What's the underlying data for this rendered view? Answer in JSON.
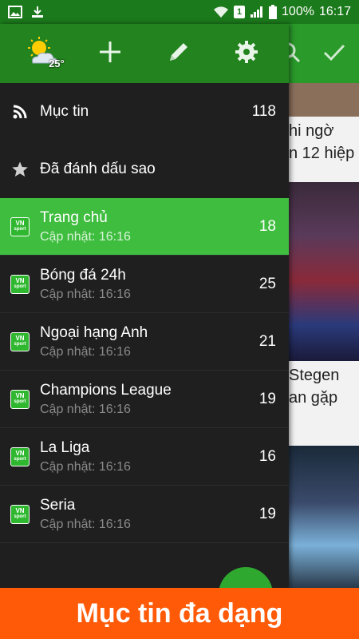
{
  "status_bar": {
    "battery": "100%",
    "time": "16:17",
    "sim_slot": "1"
  },
  "background": {
    "snippets": [
      "hi ngờ",
      "n 12 hiệp",
      "Stegen",
      "an gặp"
    ]
  },
  "drawer": {
    "header_icons": [
      "weather-icon",
      "add-icon",
      "edit-icon",
      "settings-icon"
    ],
    "weather_temp": "25°",
    "nav": [
      {
        "label": "Mục tin",
        "count": "118",
        "icon": "rss-icon"
      },
      {
        "label": "Đã đánh dấu sao",
        "count": "",
        "icon": "star-icon"
      }
    ],
    "feeds": [
      {
        "title": "Trang chủ",
        "updated": "Cập nhật: 16:16",
        "count": "18",
        "active": true
      },
      {
        "title": "Bóng đá 24h",
        "updated": "Cập nhật: 16:16",
        "count": "25",
        "active": false
      },
      {
        "title": "Ngoại hạng Anh",
        "updated": "Cập nhật: 16:16",
        "count": "21",
        "active": false
      },
      {
        "title": "Champions League",
        "updated": "Cập nhật: 16:16",
        "count": "19",
        "active": false
      },
      {
        "title": "La Liga",
        "updated": "Cập nhật: 16:16",
        "count": "16",
        "active": false
      },
      {
        "title": "Seria",
        "updated": "Cập nhật: 16:16",
        "count": "19",
        "active": false
      }
    ],
    "feed_logo_text": [
      "VN",
      "sport"
    ]
  },
  "promo": {
    "text": "Mục tin đa dạng"
  },
  "colors": {
    "status_bar": "#1b7a1b",
    "drawer_header": "#23831f",
    "active_item": "#3fbd3f",
    "drawer_bg": "#1f1f1f",
    "promo_bg": "#ff5a08"
  }
}
